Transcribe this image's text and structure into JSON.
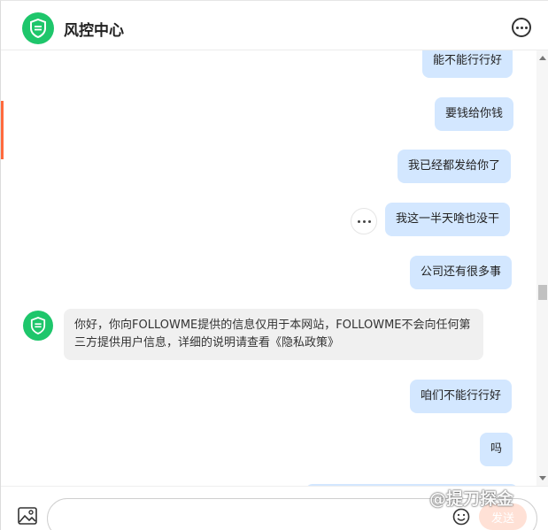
{
  "header": {
    "title": "风控中心"
  },
  "messages": [
    {
      "side": "out",
      "text": "能不能行行好"
    },
    {
      "side": "out",
      "text": "要钱给你钱"
    },
    {
      "side": "out",
      "text": "我已经都发给你了"
    },
    {
      "side": "out",
      "text": "我这一半天啥也没干"
    },
    {
      "side": "out",
      "text": "公司还有很多事"
    },
    {
      "side": "in",
      "text": "你好，你向FOLLOWME提供的信息仅用于本网站，FOLLOWME不会向任何第三方提供用户信息，详细的说明请查看《隐私政策》"
    },
    {
      "side": "out",
      "text": "咱们不能行行好"
    },
    {
      "side": "out",
      "text": "吗"
    }
  ],
  "composer": {
    "send_label": "发送",
    "input_value": ""
  },
  "watermark": {
    "text": "@提刀探金"
  },
  "icons": {
    "logo": "shield-icon",
    "menu": "more-circle-icon",
    "bubble_menu": "more-horizontal-icon",
    "attach": "image-icon",
    "emoji": "smile-icon"
  },
  "colors": {
    "accent": "#1ec66b",
    "outgoing_bubble": "#d3e7ff",
    "incoming_bubble": "#f0f0f0",
    "send_button": "#ffe1d6",
    "side_accent": "#ff6a3d"
  }
}
